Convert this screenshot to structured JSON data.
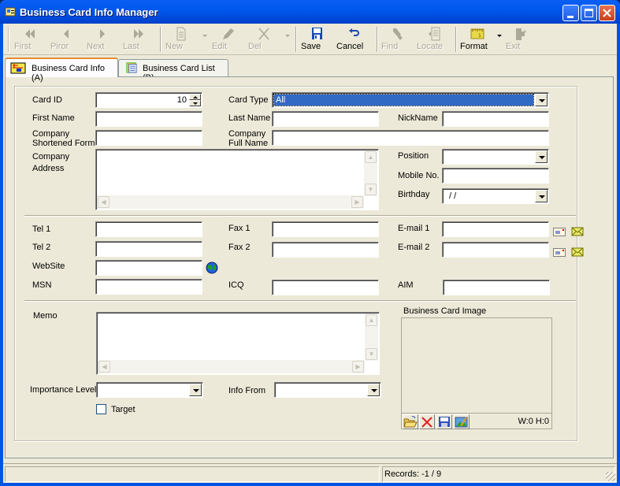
{
  "window": {
    "title": "Business Card Info Manager",
    "controls": {
      "minimize": "minimize-icon",
      "maximize": "maximize-icon",
      "close": "close-icon"
    }
  },
  "toolbar": {
    "buttons": [
      {
        "id": "first",
        "label": "First",
        "icon": "first-record-icon",
        "enabled": false
      },
      {
        "id": "prior",
        "label": "Piror",
        "icon": "prior-record-icon",
        "enabled": false
      },
      {
        "id": "next",
        "label": "Next",
        "icon": "next-record-icon",
        "enabled": false
      },
      {
        "id": "last",
        "label": "Last",
        "icon": "last-record-icon",
        "enabled": false
      },
      {
        "id": "new",
        "label": "New",
        "icon": "new-document-icon",
        "enabled": false,
        "dropdown": true
      },
      {
        "id": "edit",
        "label": "Edit",
        "icon": "edit-pen-icon",
        "enabled": false
      },
      {
        "id": "del",
        "label": "Del",
        "icon": "delete-x-icon",
        "enabled": false,
        "dropdown": true
      },
      {
        "id": "save",
        "label": "Save",
        "icon": "save-disk-icon",
        "enabled": true
      },
      {
        "id": "cancel",
        "label": "Cancel",
        "icon": "undo-arrow-icon",
        "enabled": true
      },
      {
        "id": "find",
        "label": "Find",
        "icon": "flashlight-icon",
        "enabled": false
      },
      {
        "id": "locate",
        "label": "Locate",
        "icon": "locate-icon",
        "enabled": false
      },
      {
        "id": "format",
        "label": "Format",
        "icon": "ruler-icon",
        "enabled": true,
        "dropdown": true
      },
      {
        "id": "exit",
        "label": "Exit",
        "icon": "exit-door-icon",
        "enabled": false
      }
    ]
  },
  "tabs": [
    {
      "label": "Business Card Info (A)",
      "icon": "card-info-icon",
      "active": true
    },
    {
      "label": "Business Card List (B)",
      "icon": "card-list-icon",
      "active": false
    }
  ],
  "form": {
    "card_id": {
      "label": "Card ID",
      "value": "10"
    },
    "card_type": {
      "label": "Card Type",
      "value": "All"
    },
    "first_name": {
      "label": "First Name",
      "value": ""
    },
    "last_name": {
      "label": "Last Name",
      "value": ""
    },
    "nickname": {
      "label": "NickName",
      "value": ""
    },
    "company_short": {
      "label_1": "Company",
      "label_2": "Shortened Form",
      "value": ""
    },
    "company_full": {
      "label_1": "Company",
      "label_2": "Full Name",
      "value": ""
    },
    "company_address": {
      "label_1": "Company",
      "label_2": "Address",
      "value": ""
    },
    "position": {
      "label": "Position",
      "value": ""
    },
    "mobile": {
      "label": "Mobile No.",
      "value": ""
    },
    "birthday": {
      "label": "Birthday",
      "value": " /  /"
    },
    "tel1": {
      "label": "Tel 1",
      "value": ""
    },
    "tel2": {
      "label": "Tel 2",
      "value": ""
    },
    "fax1": {
      "label": "Fax 1",
      "value": ""
    },
    "fax2": {
      "label": "Fax 2",
      "value": ""
    },
    "email1": {
      "label": "E-mail 1",
      "value": ""
    },
    "email2": {
      "label": "E-mail 2",
      "value": ""
    },
    "website": {
      "label": "WebSite",
      "value": ""
    },
    "msn": {
      "label": "MSN",
      "value": ""
    },
    "icq": {
      "label": "ICQ",
      "value": ""
    },
    "aim": {
      "label": "AIM",
      "value": ""
    },
    "memo": {
      "label": "Memo",
      "value": ""
    },
    "importance": {
      "label": "Importance Level",
      "value": ""
    },
    "info_from": {
      "label": "Info From",
      "value": ""
    },
    "target": {
      "label": "Target",
      "checked": false
    }
  },
  "image_panel": {
    "title": "Business Card Image",
    "size_text": "W:0  H:0",
    "tools": [
      "open-folder-icon",
      "delete-image-icon",
      "save-image-icon",
      "edit-image-icon"
    ]
  },
  "status": {
    "left": "",
    "records": "Records: -1 / 9"
  }
}
